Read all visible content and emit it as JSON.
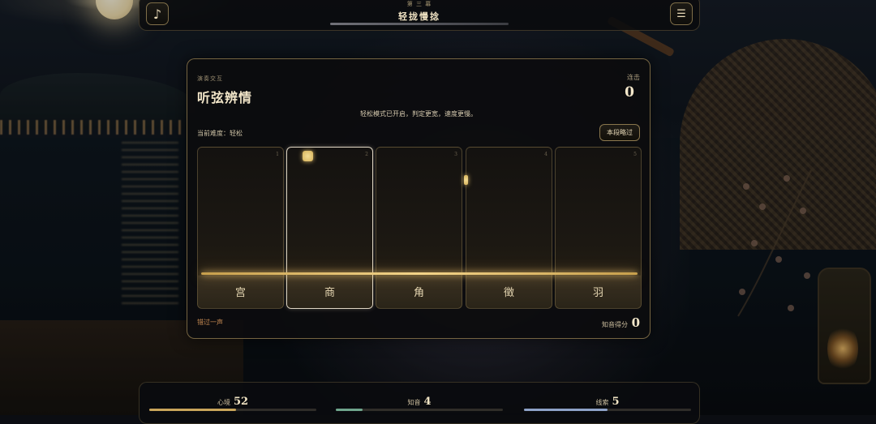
{
  "topbar": {
    "chapter": "第 三 幕",
    "title": "轻拢慢捻",
    "music_icon": "♪",
    "menu_icon": "☰"
  },
  "panel": {
    "eyebrow": "演奏交互",
    "title": "听弦辨情",
    "combo_label": "连击",
    "combo_value": "0",
    "mode_note": "轻松模式已开启，判定更宽，速度更慢。",
    "difficulty": "当前难度：轻松",
    "skip_label": "本段略过",
    "miss_text": "错过一声",
    "score_label": "知音得分",
    "score_value": "0",
    "lanes": [
      {
        "num": "1",
        "name": "宫"
      },
      {
        "num": "2",
        "name": "商"
      },
      {
        "num": "3",
        "name": "角"
      },
      {
        "num": "4",
        "name": "徵"
      },
      {
        "num": "5",
        "name": "羽"
      }
    ],
    "active_lane": 2
  },
  "status": {
    "mood": {
      "label": "心境",
      "value": "52",
      "level": 0.52,
      "color": "#c9a55a"
    },
    "zhiyin": {
      "label": "知音",
      "value": "4",
      "level": 0.16,
      "color": "#6fa58c"
    },
    "clues": {
      "label": "线索",
      "value": "5",
      "level": 0.5,
      "color": "#8ea2c8"
    }
  },
  "colors": {
    "accent": "#d6b25a",
    "panel_border": "#cdaf6e"
  }
}
